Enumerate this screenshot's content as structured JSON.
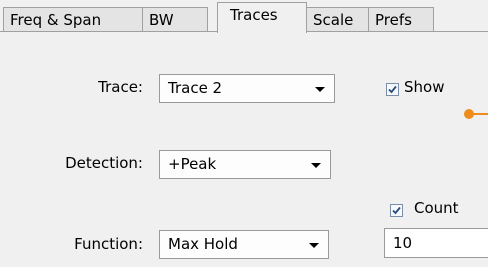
{
  "tabs": [
    {
      "label": "Freq & Span"
    },
    {
      "label": "BW"
    },
    {
      "label": "Traces"
    },
    {
      "label": "Scale"
    },
    {
      "label": "Prefs"
    }
  ],
  "active_tab": "Traces",
  "trace": {
    "label": "Trace:",
    "value": "Trace 2"
  },
  "detection": {
    "label": "Detection:",
    "value": "+Peak"
  },
  "function": {
    "label": "Function:",
    "value": "Max Hold"
  },
  "show": {
    "label": "Show",
    "checked": true
  },
  "count": {
    "label": "Count",
    "checked": true,
    "value": "10"
  },
  "colors": {
    "cursor": "#f08c1e",
    "panel_bg": "#f0f0f0"
  }
}
